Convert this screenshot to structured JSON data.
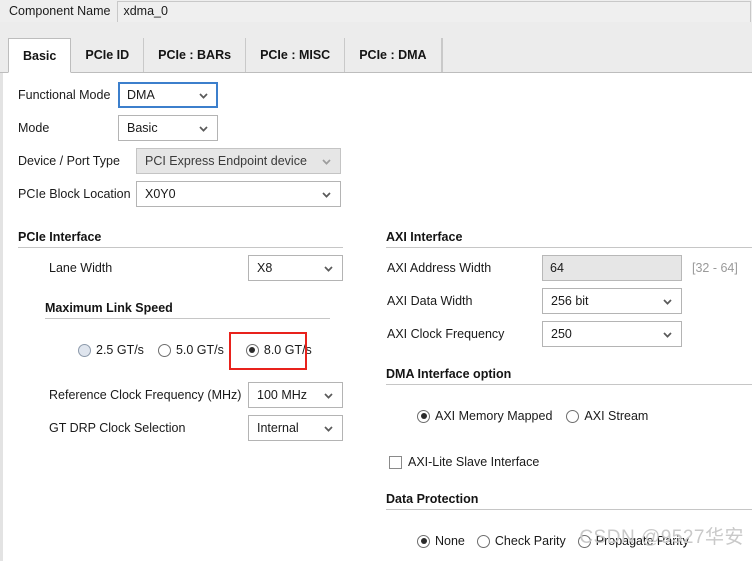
{
  "header": {
    "component_name_label": "Component Name",
    "component_name_value": "xdma_0"
  },
  "tabs": [
    {
      "label": "Basic",
      "active": true
    },
    {
      "label": "PCIe ID",
      "active": false
    },
    {
      "label": "PCIe : BARs",
      "active": false
    },
    {
      "label": "PCIe : MISC",
      "active": false
    },
    {
      "label": "PCIe : DMA",
      "active": false
    }
  ],
  "left_panel": {
    "fields": [
      {
        "label": "Functional Mode",
        "value": "DMA",
        "state": "focused"
      },
      {
        "label": "Mode",
        "value": "Basic",
        "state": "normal"
      },
      {
        "label": "Device / Port Type",
        "value": "PCI Express Endpoint device",
        "state": "disabled"
      },
      {
        "label": "PCIe Block Location",
        "value": "X0Y0",
        "state": "normal"
      }
    ],
    "pcie_interface": {
      "title": "PCIe Interface",
      "lane_width_label": "Lane Width",
      "lane_width_value": "X8",
      "max_link_speed_title": "Maximum Link Speed",
      "link_speed_options": [
        {
          "label": "2.5 GT/s",
          "checked": false,
          "shaded": true
        },
        {
          "label": "5.0 GT/s",
          "checked": false,
          "shaded": false
        },
        {
          "label": "8.0 GT/s",
          "checked": true,
          "shaded": false
        }
      ],
      "ref_clock_label": "Reference Clock Frequency (MHz)",
      "ref_clock_value": "100 MHz",
      "gt_drp_label": "GT DRP Clock Selection",
      "gt_drp_value": "Internal"
    }
  },
  "right_panel": {
    "axi_interface": {
      "title": "AXI Interface",
      "address_width_label": "AXI Address Width",
      "address_width_value": "64",
      "address_width_range": "[32 - 64]",
      "data_width_label": "AXI Data Width",
      "data_width_value": "256 bit",
      "clock_freq_label": "AXI Clock Frequency",
      "clock_freq_value": "250"
    },
    "dma_interface": {
      "title": "DMA Interface option",
      "options": [
        {
          "label": "AXI Memory Mapped",
          "checked": true
        },
        {
          "label": "AXI Stream",
          "checked": false
        }
      ],
      "axi_lite_label": "AXI-Lite Slave Interface",
      "axi_lite_checked": false
    },
    "data_protection": {
      "title": "Data Protection",
      "options": [
        {
          "label": "None",
          "checked": true
        },
        {
          "label": "Check Parity",
          "checked": false
        },
        {
          "label": "Propagate Parity",
          "checked": false
        }
      ]
    }
  },
  "watermark": "CSDN @9527华安",
  "colors": {
    "accent_focus": "#3c7fcc",
    "highlight_red": "#e8221c",
    "panel_bg": "#ececec",
    "disabled_bg": "#e6e6e6"
  }
}
